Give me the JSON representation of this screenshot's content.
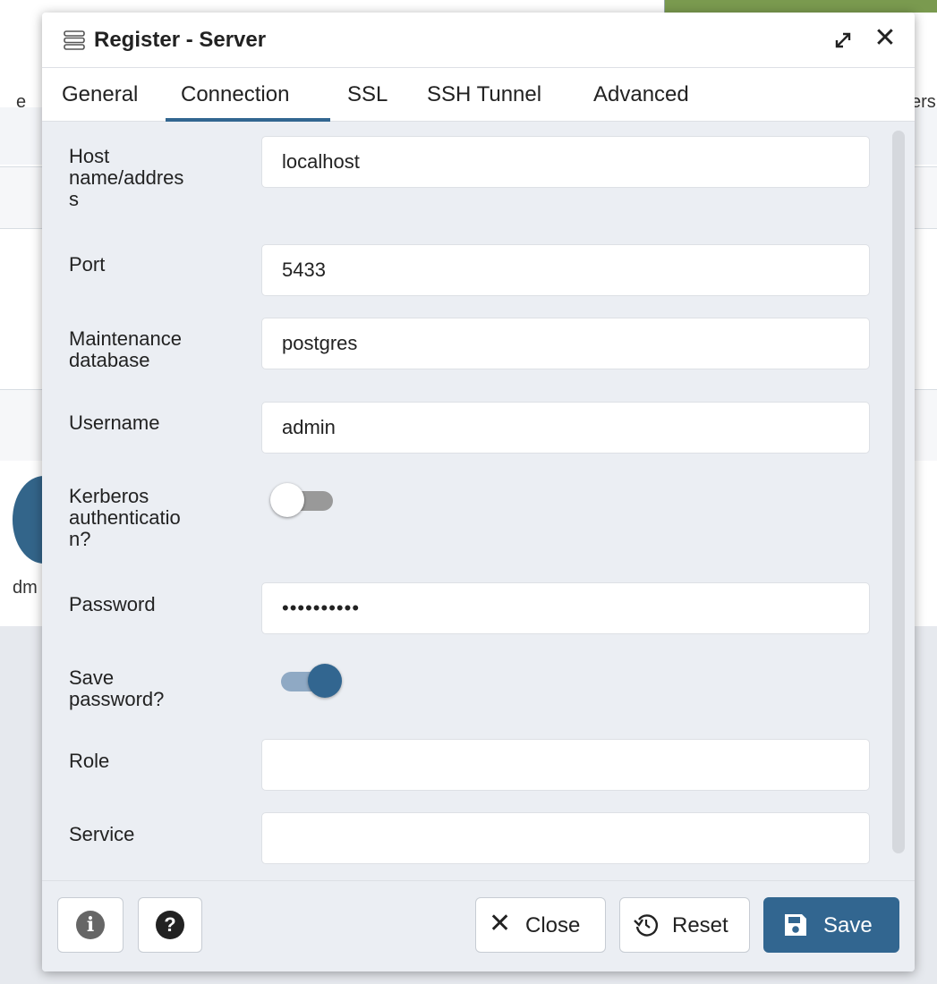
{
  "background": {
    "left_fragment": "e",
    "right_fragment": "ers",
    "lower_fragment": "dm"
  },
  "dialog": {
    "title": "Register - Server",
    "title_icon": "server-icon",
    "maximize_icon": "maximize-icon",
    "close_icon": "close-icon",
    "close_glyph": "✕"
  },
  "tabs": [
    {
      "label": "General",
      "active": false
    },
    {
      "label": "Connection",
      "active": true
    },
    {
      "label": "SSL",
      "active": false
    },
    {
      "label": "SSH Tunnel",
      "active": false
    },
    {
      "label": "Advanced",
      "active": false
    }
  ],
  "form": {
    "host": {
      "label": "Host name/addres s",
      "label_lines": [
        "Host",
        "name/addres",
        "s"
      ],
      "value": "localhost"
    },
    "port": {
      "label": "Port",
      "value": "5433"
    },
    "maintenance_db": {
      "label": "Maintenance database",
      "label_lines": [
        "Maintenance",
        "database"
      ],
      "value": "postgres"
    },
    "username": {
      "label": "Username",
      "value": "admin"
    },
    "kerberos": {
      "label": "Kerberos authenticatio n?",
      "label_lines": [
        "Kerberos",
        "authenticatio",
        "n?"
      ],
      "enabled": false
    },
    "password": {
      "label": "Password",
      "value": "••••••••••"
    },
    "save_password": {
      "label": "Save password?",
      "label_lines": [
        "Save",
        "password?"
      ],
      "enabled": true
    },
    "role": {
      "label": "Role",
      "value": ""
    },
    "service": {
      "label": "Service",
      "value": ""
    }
  },
  "footer": {
    "info_glyph": "i",
    "help_glyph": "?",
    "close_glyph": "✕",
    "close_label": "Close",
    "reset_label": "Reset",
    "save_label": "Save"
  },
  "colors": {
    "accent": "#326690",
    "toggle_on_track": "#8fa9c4",
    "toggle_off_track": "#999999",
    "dialog_bg": "#ebeef3"
  }
}
